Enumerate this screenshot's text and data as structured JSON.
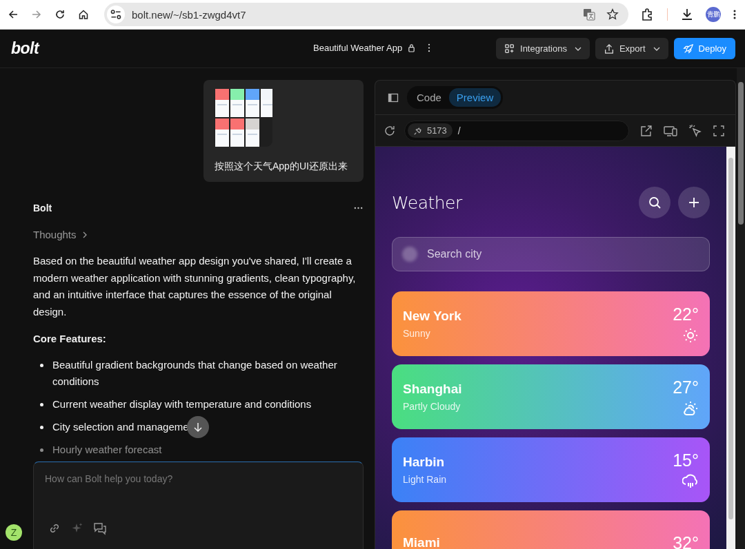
{
  "browser": {
    "url": "bolt.new/~/sb1-zwgd4vt7",
    "profile": "青鹏"
  },
  "header": {
    "logo": "bolt",
    "project_title": "Beautiful Weather App",
    "buttons": [
      {
        "label": "Integrations",
        "kind": "menu"
      },
      {
        "label": "Export",
        "kind": "menu"
      },
      {
        "label": "Deploy",
        "kind": "primary"
      }
    ]
  },
  "chat": {
    "user_message": {
      "text": "按照这个天气App的UI还原出来"
    },
    "assistant": {
      "name": "Bolt",
      "thoughts": "Thoughts",
      "paragraph": "Based on the beautiful weather app design you've shared, I'll create a modern weather application with stunning gradients, clean typography, and an intuitive interface that captures the essence of the original design.",
      "heading": "Core Features:",
      "features": [
        "Beautiful gradient backgrounds that change based on weather conditions",
        "Current weather display with temperature and conditions",
        "City selection and manageme",
        "Hourly weather forecast"
      ]
    },
    "input": {
      "placeholder": "How can Bolt help you today?"
    },
    "user_avatar": "Z"
  },
  "preview": {
    "tabs": [
      {
        "label": "Code",
        "selected": false
      },
      {
        "label": "Preview",
        "selected": true
      }
    ],
    "port": "5173",
    "path": "/",
    "app": {
      "title": "Weather",
      "search_placeholder": "Search city",
      "cities": [
        {
          "name": "New York",
          "condition": "Sunny",
          "temp": "22°",
          "kind": "sunny",
          "color": "#fb923c"
        },
        {
          "name": "Shanghai",
          "condition": "Partly Cloudy",
          "temp": "27°",
          "kind": "partly_cloudy",
          "color": "#4ade80"
        },
        {
          "name": "Harbin",
          "condition": "Light Rain",
          "temp": "15°",
          "kind": "rain",
          "color": "#3b82f6"
        },
        {
          "name": "Miami",
          "temp": "32°",
          "color": "#fb923c"
        }
      ]
    }
  }
}
